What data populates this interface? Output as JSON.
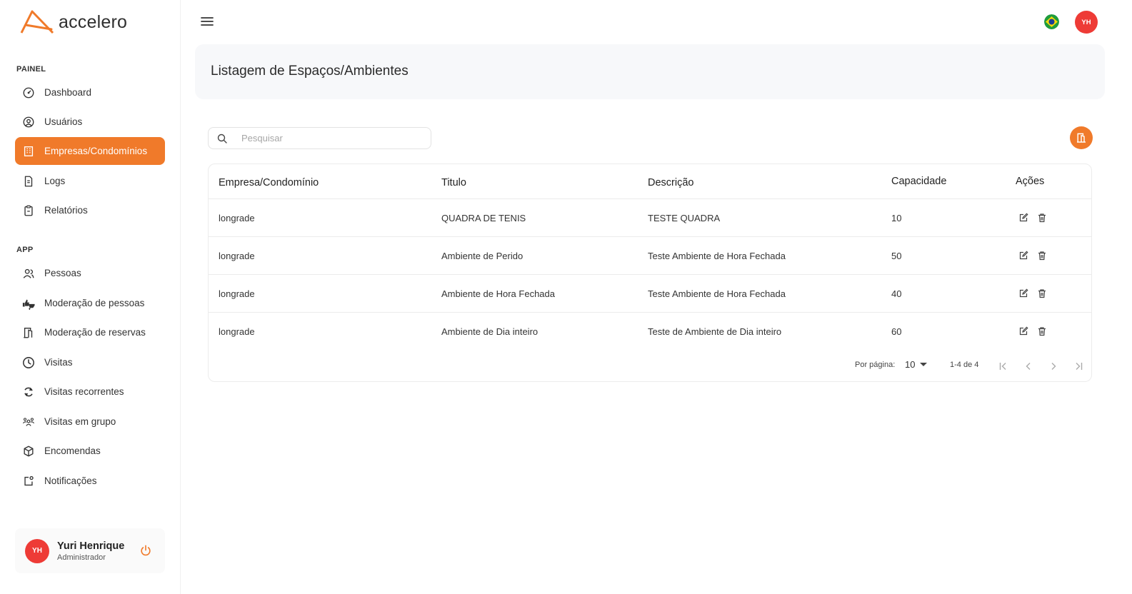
{
  "app": {
    "name": "accelero",
    "brand_color": "#f07a2a",
    "avatar_color": "#ee3b36"
  },
  "sidebar": {
    "sections": [
      {
        "label": "PAINEL"
      },
      {
        "label": "APP"
      }
    ],
    "items": [
      {
        "label": "Dashboard",
        "icon": "dashboard-icon"
      },
      {
        "label": "Usuários",
        "icon": "user-circle-icon"
      },
      {
        "label": "Empresas/Condomínios",
        "icon": "building-icon",
        "active": true
      },
      {
        "label": "Logs",
        "icon": "file-icon"
      },
      {
        "label": "Relatórios",
        "icon": "clipboard-icon"
      },
      {
        "label": "Pessoas",
        "icon": "people-icon"
      },
      {
        "label": "Moderação de pessoas",
        "icon": "thumbs-icon"
      },
      {
        "label": "Moderação de reservas",
        "icon": "door-icon"
      },
      {
        "label": "Visitas",
        "icon": "clock-icon"
      },
      {
        "label": "Visitas recorrentes",
        "icon": "refresh-icon"
      },
      {
        "label": "Visitas em grupo",
        "icon": "group-icon"
      },
      {
        "label": "Encomendas",
        "icon": "package-icon"
      },
      {
        "label": "Notificações",
        "icon": "notification-icon"
      }
    ],
    "user": {
      "initials": "YH",
      "name": "Yuri Henrique",
      "role": "Administrador"
    }
  },
  "topbar": {
    "avatar_initials": "YH"
  },
  "page": {
    "title": "Listagem de Espaços/Ambientes"
  },
  "search": {
    "placeholder": "Pesquisar",
    "value": ""
  },
  "table": {
    "headers": [
      "Empresa/Condomínio",
      "Titulo",
      "Descrição",
      "Capacidade",
      "Ações"
    ],
    "rows": [
      [
        "longrade",
        "QUADRA DE TENIS",
        "TESTE QUADRA",
        "10"
      ],
      [
        "longrade",
        "Ambiente de Perido",
        "Teste Ambiente de Hora Fechada",
        "50"
      ],
      [
        "longrade",
        "Ambiente de Hora Fechada",
        "Teste Ambiente de Hora Fechada",
        "40"
      ],
      [
        "longrade",
        "Ambiente de Dia inteiro",
        "Teste de Ambiente de Dia inteiro",
        "60"
      ]
    ]
  },
  "pagination": {
    "per_page_label": "Por página:",
    "per_page_value": "10",
    "range": "1-4 de 4"
  }
}
